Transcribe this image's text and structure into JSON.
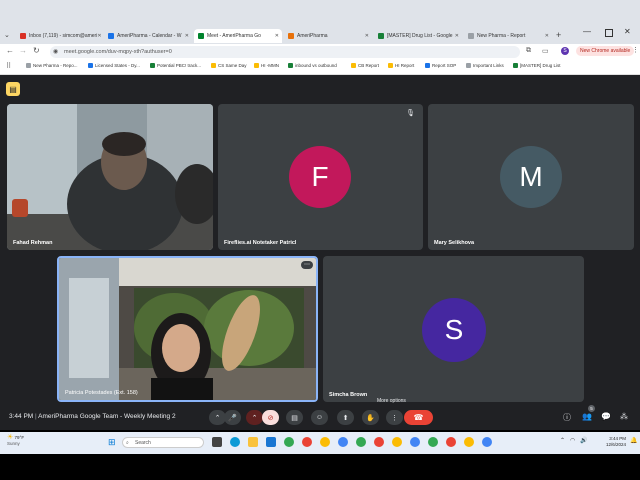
{
  "browser": {
    "tabs": [
      {
        "label": "Inbox (7,119) - simcom@ameri",
        "color": "#d93025"
      },
      {
        "label": "AmeriPharma - Calendar - W",
        "color": "#1a73e8"
      },
      {
        "label": "Meet - AmeriPharma Go",
        "color": "#00832d",
        "active": true
      },
      {
        "label": "AmeriPharma",
        "color": "#e8710a"
      },
      {
        "label": "[MASTER] Drug List - Google",
        "color": "#188038"
      },
      {
        "label": "New Pharma - Report",
        "color": "#9aa0a6"
      }
    ],
    "url": "meet.google.com/duv-mqpy-xth?authuser=0",
    "new_chrome_label": "New Chrome available",
    "bookmarks": [
      "New Pharma - Repo...",
      "Licensed States - Dy...",
      "Potential PBC! track...",
      "CS Same Day",
      "HI -MMN",
      "inbound vs outbound",
      "CB Report",
      "HI Report",
      "Report SOP",
      "Important Links",
      "[MASTER] Drug List"
    ]
  },
  "participants": [
    {
      "name": "Fahad Rehman",
      "type": "video"
    },
    {
      "name": "Fireflies.ai Notetaker Patricl",
      "type": "avatar",
      "initial": "F",
      "color": "#c2185b"
    },
    {
      "name": "Mary Selikhova",
      "type": "avatar",
      "initial": "M",
      "color": "#455a64"
    },
    {
      "name": "Patricia Potestades (Ext. 158)",
      "type": "video"
    },
    {
      "name": "Simcha Brown",
      "type": "avatar",
      "initial": "S",
      "color": "#4527a0"
    }
  ],
  "meeting": {
    "time": "3:44 PM",
    "title": "AmeriPharma Google Team - Weekly Meeting 2",
    "tooltip": "More options",
    "people_count": "5"
  },
  "taskbar": {
    "weather_temp": "79°F",
    "weather_desc": "Sunny",
    "search_placeholder": "Search",
    "clock_time": "3:44 PM",
    "clock_date": "12/6/2024"
  }
}
